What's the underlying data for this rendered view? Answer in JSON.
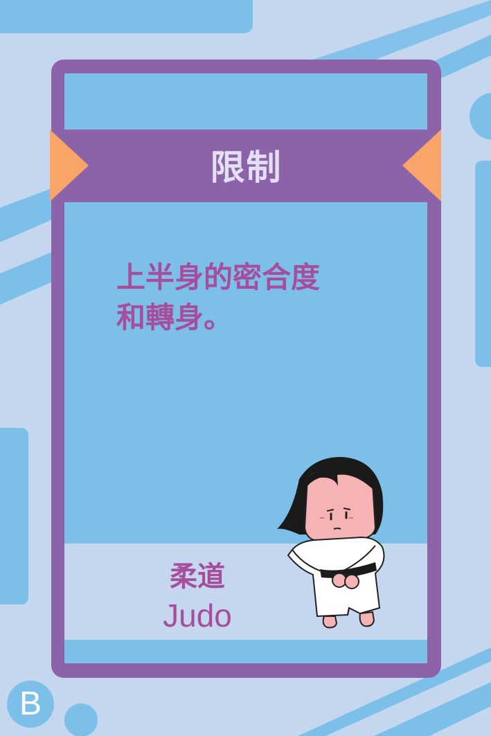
{
  "banner": {
    "title": "限制"
  },
  "rule": {
    "lines": [
      "上半身的密合度",
      "和轉身。"
    ]
  },
  "sport": {
    "name_zh": "柔道",
    "name_en": "Judo"
  },
  "badge": {
    "letter": "B"
  },
  "character": {
    "icon": "judo-character-illustration"
  },
  "colors": {
    "background": "#c5d7ee",
    "card_frame": "#8c62a8",
    "card_panel": "#7cc0ea",
    "accent_triangle": "#f9a468",
    "text_purple": "#a64d9b",
    "title_text": "#e3e0f2"
  }
}
